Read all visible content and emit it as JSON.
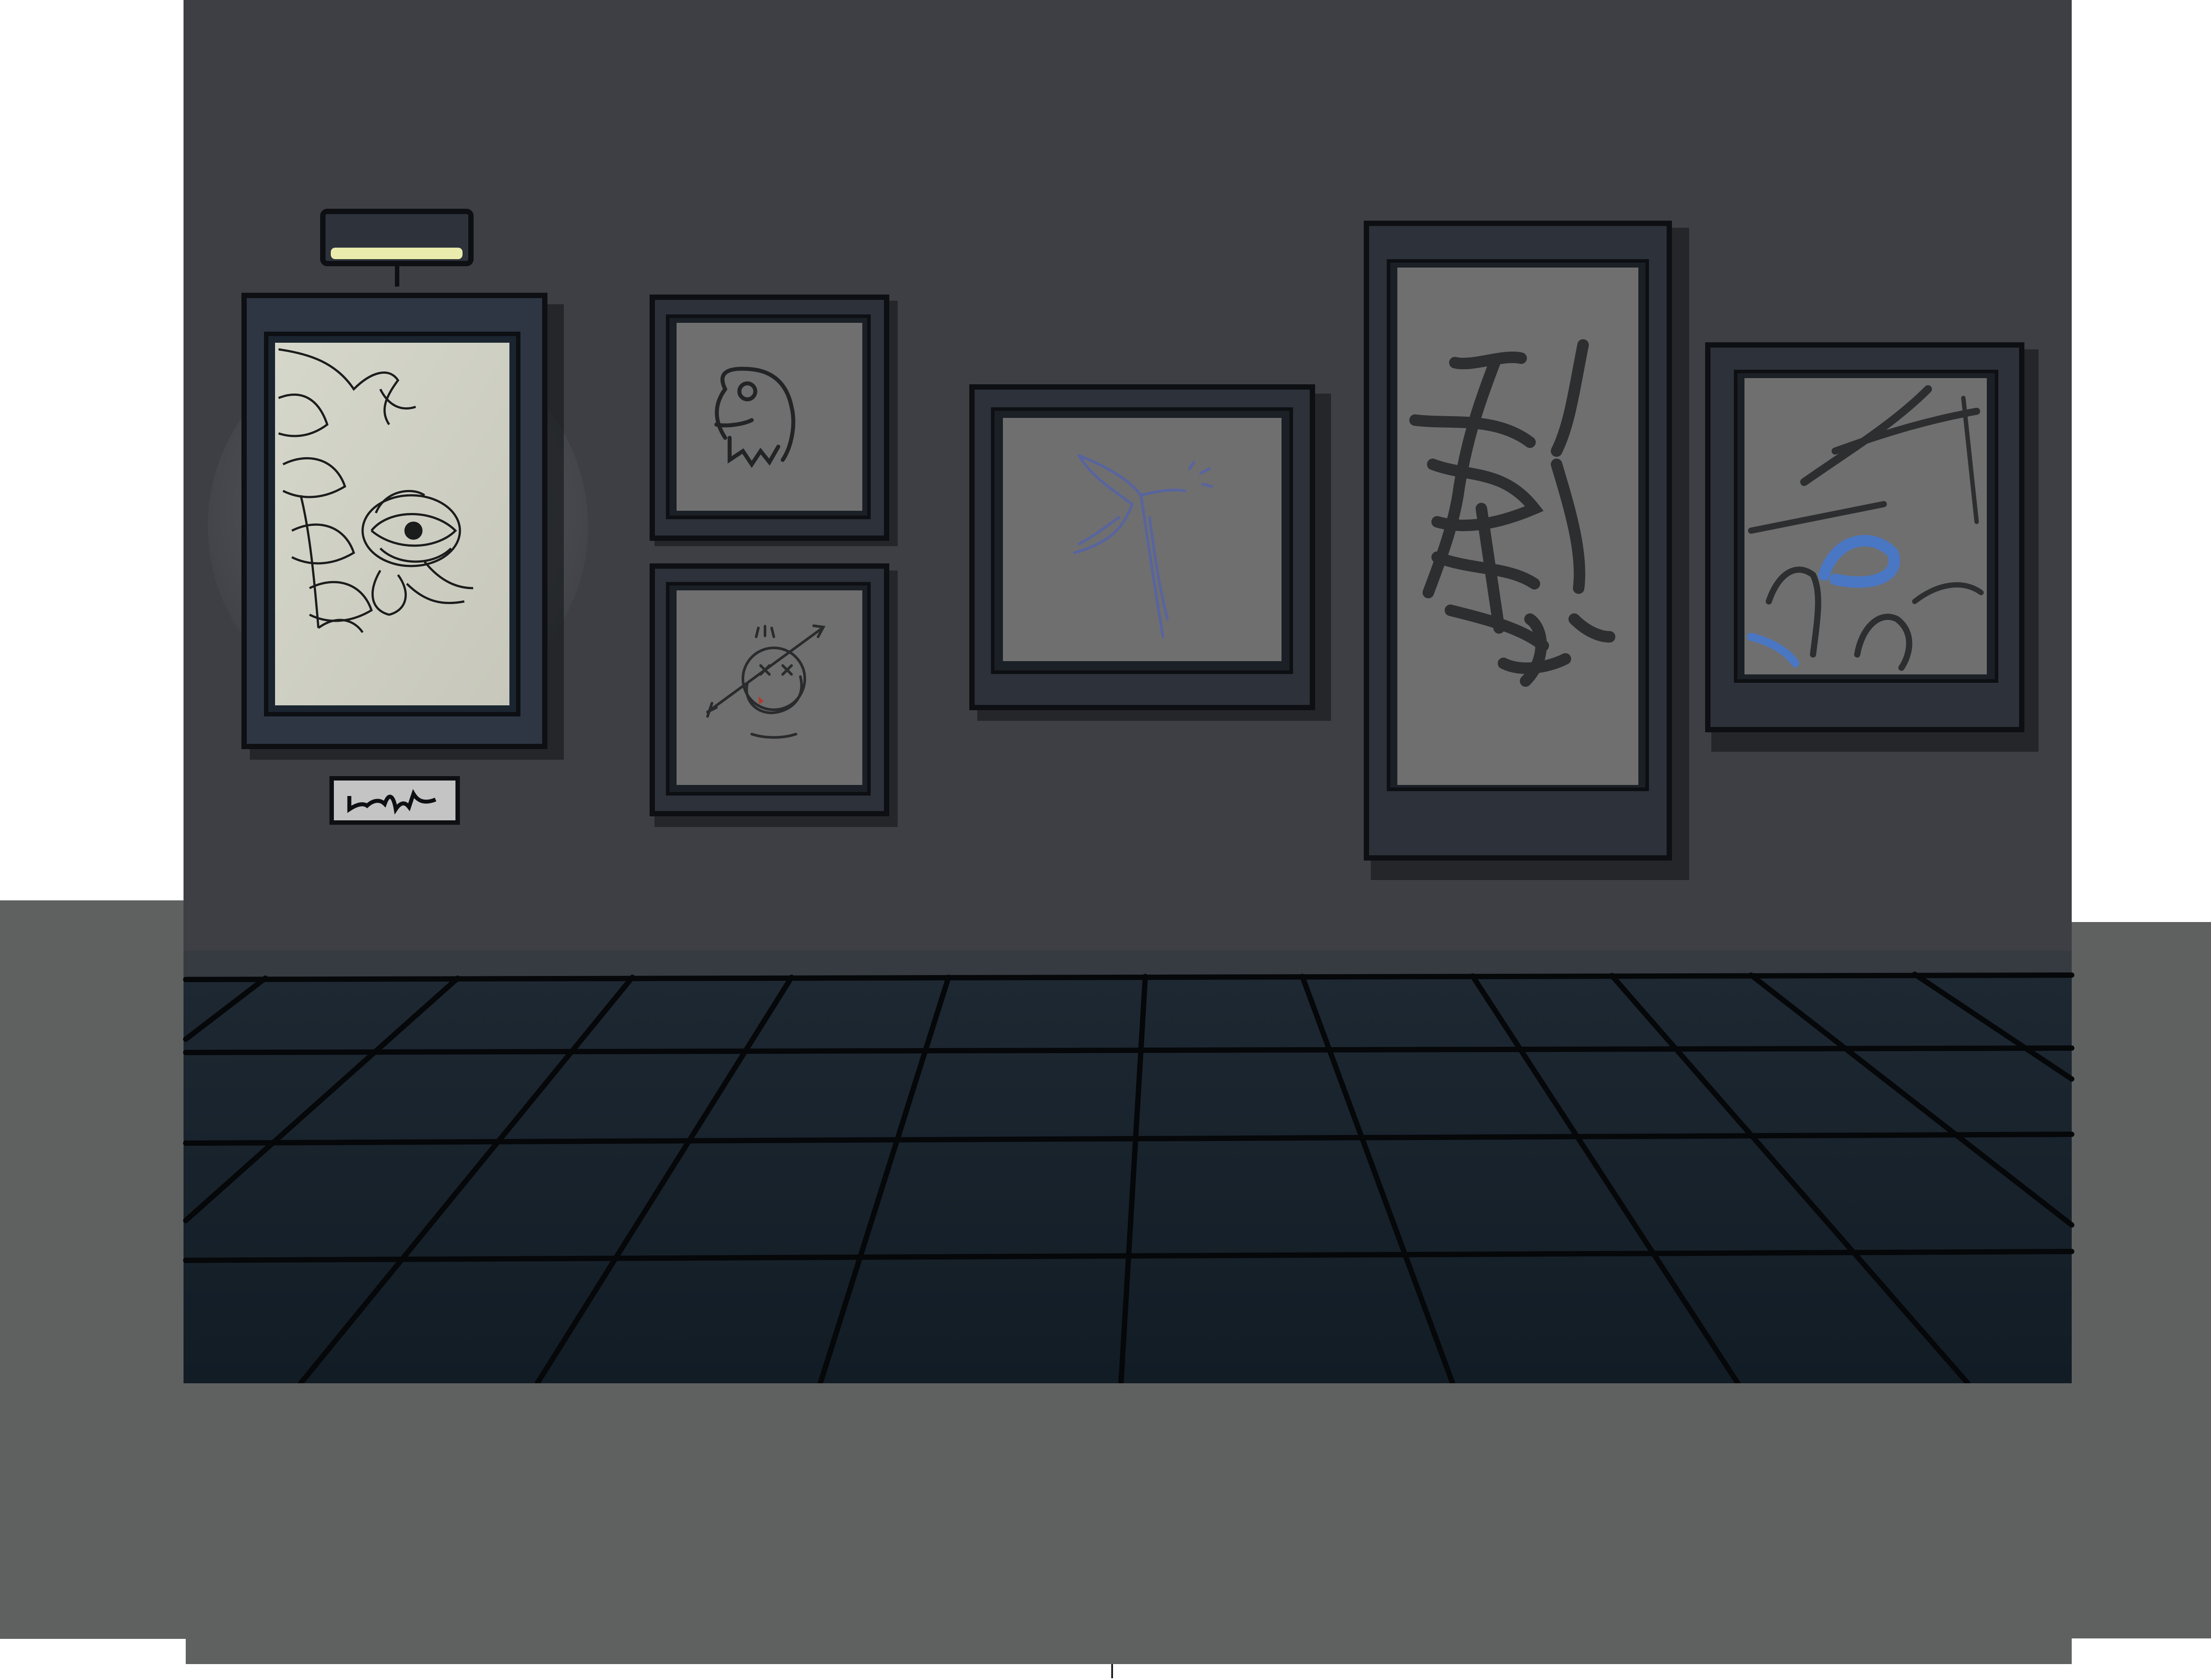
{
  "scene": {
    "name": "gallery-room",
    "colors": {
      "background": "#ffffff",
      "side_panels": "#5f6160",
      "wall": "#3d3f44",
      "floor_dark": "#141e27",
      "floor_light": "#1c2630",
      "outline": "#0d0f12",
      "frame": "#2c313a",
      "frame_inner": "#1b1f26",
      "canvas_gray": "#6f6f6f",
      "lit_canvas": "#d2d3c6",
      "lamp_light": "#e9ecac",
      "bird_ink": "#5864a0",
      "graffiti_blue": "#4a77c4",
      "graffiti_ink": "#2d2e30"
    },
    "artworks": [
      {
        "id": "flower-painting",
        "icon": "peony-flower-icon",
        "lit": true
      },
      {
        "id": "skull-bird-sketch",
        "icon": "bird-skull-icon"
      },
      {
        "id": "scribble-face-sketch",
        "icon": "scribble-face-icon"
      },
      {
        "id": "swallow-sketch",
        "icon": "swallow-bird-icon"
      },
      {
        "id": "graffiti-tag",
        "icon": "graffiti-tag-icon"
      },
      {
        "id": "graffiti-abstract",
        "icon": "graffiti-strokes-icon"
      }
    ],
    "placard_icon": "signature-scribble-icon",
    "lamp_icon": "picture-lamp-icon"
  }
}
